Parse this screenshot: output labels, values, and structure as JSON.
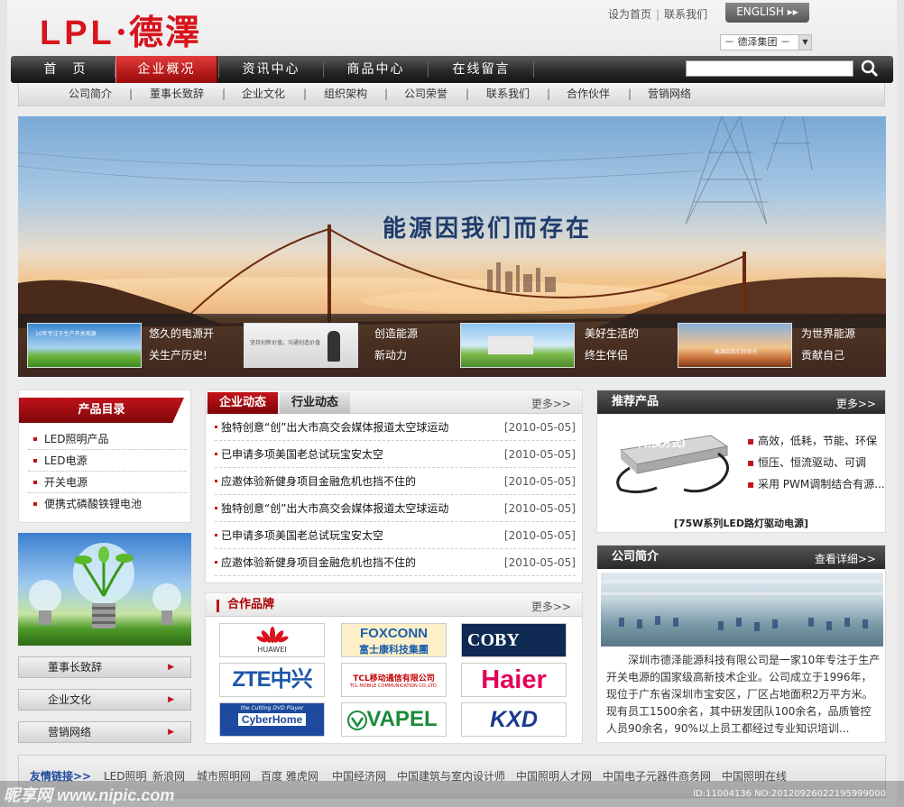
{
  "header": {
    "logo_text": "LPL",
    "logo_cn": "·德澤",
    "set_home": "设为首页",
    "sep": "|",
    "contact": "联系我们",
    "english": "ENGLISH ▸▸",
    "group_select": "－ 德泽集团 －"
  },
  "nav": {
    "items": [
      "首　页",
      "企业概况",
      "资讯中心",
      "商品中心",
      "在线留言"
    ],
    "active": 1
  },
  "subnav": [
    "公司简介",
    "董事长致辞",
    "企业文化",
    "组织架构",
    "公司荣誉",
    "联系我们",
    "合作伙伴",
    "营销网络"
  ],
  "banner": {
    "slogan": "能源因我们而存在",
    "thumbs": [
      {
        "line1": "悠久的电源开",
        "line2": "关生产历史!"
      },
      {
        "line1": "创造能源",
        "line2": "新动力"
      },
      {
        "line1": "美好生活的",
        "line2": "终生伴侣"
      },
      {
        "line1": "为世界能源",
        "line2": "贡献自己"
      }
    ],
    "thumb_caption1": "10年专注于生产开关电源",
    "thumb_caption2": "坚持创新价值，沟通创造价值",
    "thumb_caption4": "能源因我们而存在"
  },
  "catalog": {
    "title": "产品目录",
    "items": [
      "LED照明产品",
      "LED电源",
      "开关电源",
      "便携式磷酸铁锂电池"
    ]
  },
  "side_buttons": [
    "董事长致辞",
    "企业文化",
    "营销网络"
  ],
  "news": {
    "tab_active": "企业动态",
    "tab_other": "行业动态",
    "more": "更多>>",
    "rows": [
      {
        "title": "独特创意“创”出大市高交会媒体报道太空球运动",
        "date": "[2010-05-05]"
      },
      {
        "title": "已申请多项美国老总试玩宝安太空",
        "date": "[2010-05-05]"
      },
      {
        "title": "应邀体验新健身项目金融危机也挡不住的",
        "date": "[2010-05-05]"
      },
      {
        "title": "独特创意“创”出大市高交会媒体报道太空球运动",
        "date": "[2010-05-05]"
      },
      {
        "title": "已申请多项美国老总试玩宝安太空",
        "date": "[2010-05-05]"
      },
      {
        "title": "应邀体验新健身项目金融危机也挡不住的",
        "date": "[2010-05-05]"
      }
    ]
  },
  "brands": {
    "title": "合作品牌",
    "more": "更多>>",
    "items": [
      {
        "name": "HUAWEI",
        "color": "#d8141c"
      },
      {
        "name": "FOXCONN",
        "sub": "富士康科技集團",
        "color": "#1b5fae"
      },
      {
        "name": "COBY",
        "color": "#ffffff"
      },
      {
        "name": "ZTE中兴",
        "color": "#1a56a8"
      },
      {
        "name": "TCL移动通信有限公司",
        "sub": "TCL MOBILE COMMUNICATION CO.,LTD.",
        "color": "#c40000"
      },
      {
        "name": "Haier",
        "color": "#e3005a"
      },
      {
        "name": "CyberHome",
        "sub": "the Cutting DVD Player",
        "color": "#1b4a9e"
      },
      {
        "name": "VAPEL",
        "color": "#1a8a3a"
      },
      {
        "name": "KXD",
        "color": "#1b3a8e"
      }
    ]
  },
  "recommend": {
    "title": "推荐产品",
    "more": "更多>>",
    "img_label": "(切换方式)",
    "features": [
      "高效，低耗，节能、环保",
      "恒压、恒流驱动、可调",
      "采用 PWM调制结合有源..."
    ],
    "caption": "[75W系列LED路灯驱动电源]"
  },
  "company": {
    "title": "公司简介",
    "more": "查看详细>>",
    "text": "深圳市德泽能源科技有限公司是一家10年专注于生产开关电源的国家级高新技术企业。公司成立于1996年，现位于广东省深圳市宝安区，厂区占地面积2万平方米。现有员工1500余名，其中研发团队100余名，品质管控人员90余名，90%以上员工都经过专业知识培训..."
  },
  "footer": {
    "label": "友情链接>>",
    "links": [
      "LED照明",
      "新浪网",
      "城市照明网",
      "百度 雅虎网",
      "中国经济网",
      "中国建筑与室内设计师",
      "中国照明人才网",
      "中国电子元器件商务网",
      "中国照明在线"
    ]
  },
  "watermark": {
    "left": "昵享网 www.nipic.com",
    "right": "ID:11004136 NO:20120926022195999000"
  },
  "colors": {
    "accent": "#c0141a",
    "nav_dark": "#222222",
    "title_blue": "#1e3c6a"
  }
}
